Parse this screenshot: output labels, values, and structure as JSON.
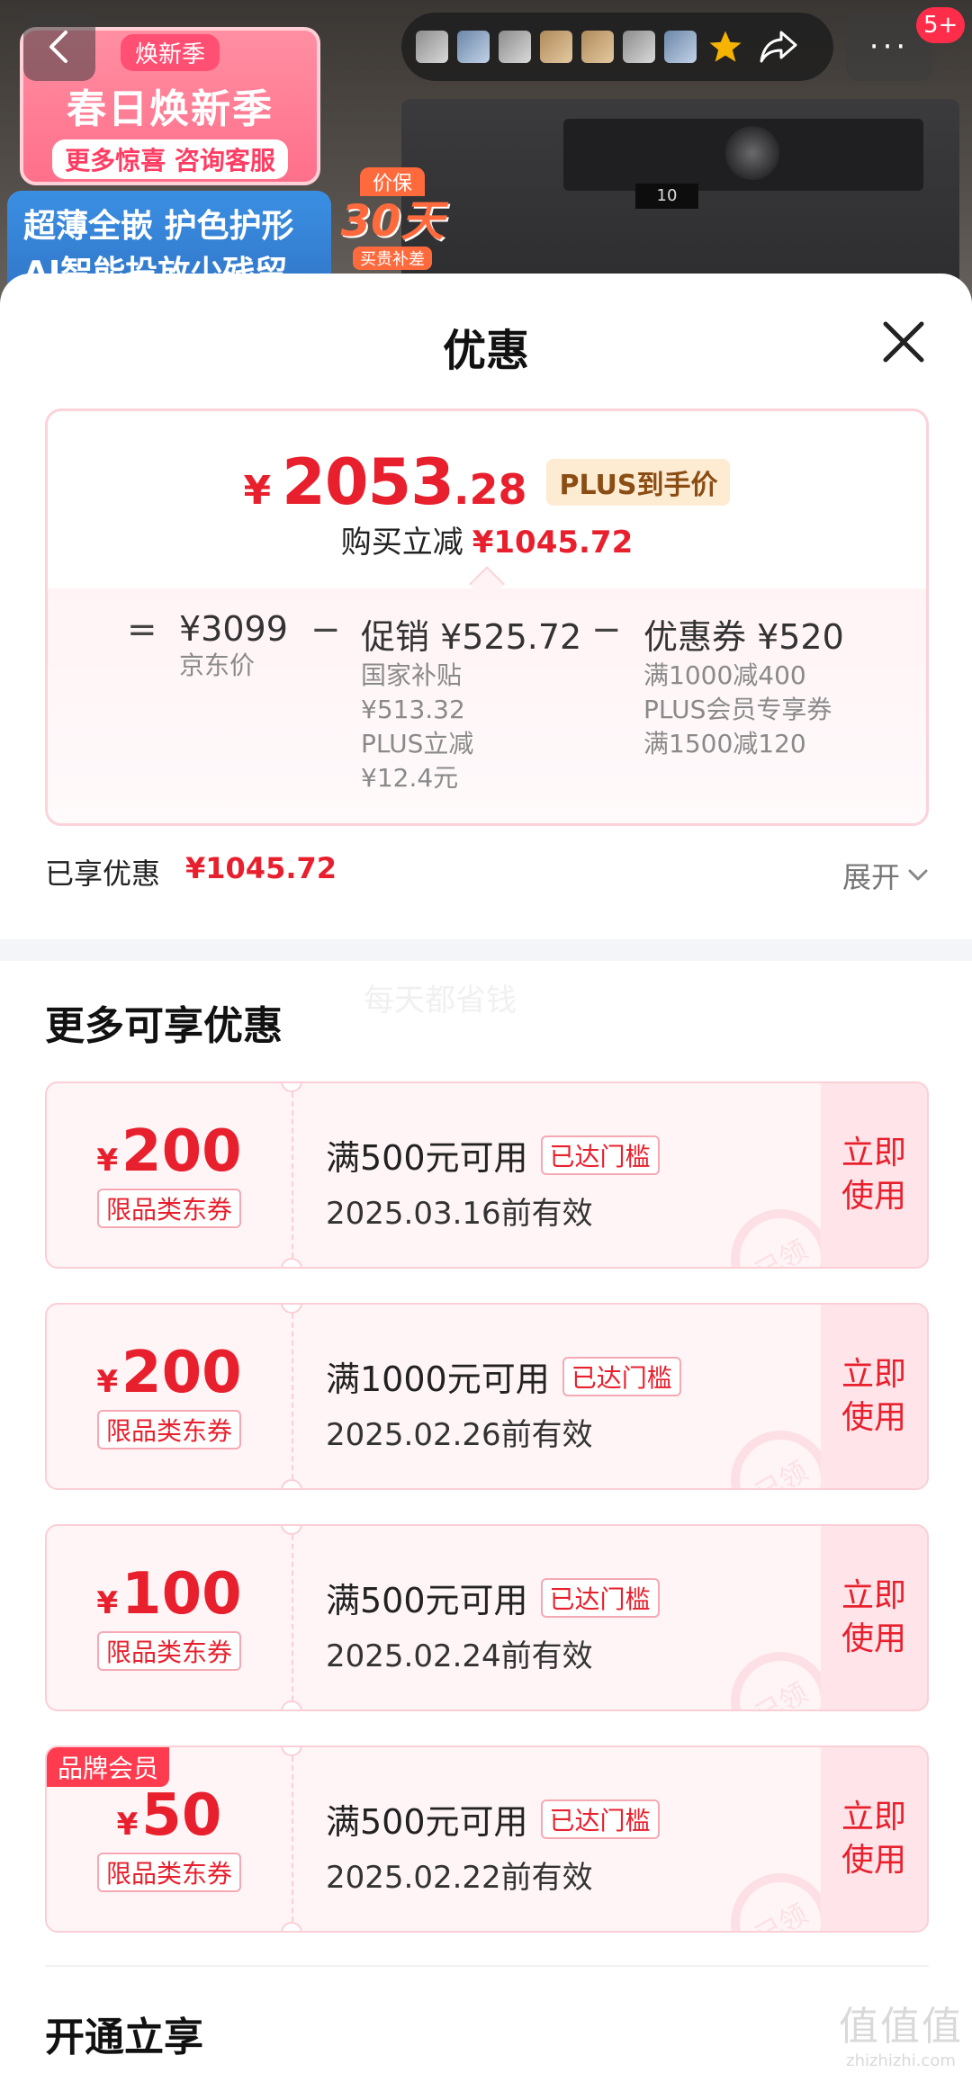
{
  "hero": {
    "promo_tag": "焕新季",
    "promo_main": "春日焕新季",
    "promo_sub": "更多惊喜 咨询客服",
    "feature_lines": [
      "超薄全嵌 护色护形",
      "AI智能投放少残留"
    ],
    "price_guard_top": "价保",
    "price_guard_mid": "30天",
    "price_guard_bot": "买贵补差",
    "washer_display": "10",
    "badge": "5+",
    "more": "···"
  },
  "sheet": {
    "title": "优惠"
  },
  "summary": {
    "final_price": {
      "symbol": "¥",
      "integer": "2053",
      "decimal": ".28",
      "tag": "PLUS到手价"
    },
    "instant_cut": {
      "label": "购买立减",
      "amount": "¥1045.72"
    },
    "calc": {
      "eq": "=",
      "minus": "−",
      "jd_price": {
        "main": "¥3099",
        "sub": "京东价"
      },
      "promo": {
        "main": "促销 ¥525.72",
        "lines": [
          "国家补贴",
          "¥513.32",
          "PLUS立减",
          "¥12.4元"
        ]
      },
      "coupon": {
        "main": "优惠券 ¥520",
        "lines": [
          "满1000减400",
          "PLUS会员专享券",
          "满1500减120"
        ]
      }
    }
  },
  "enjoyed": {
    "label": "已享优惠",
    "amount": "¥1045.72",
    "expand": "展开"
  },
  "watermark": "每天都省钱",
  "more_section": {
    "title": "更多可享优惠"
  },
  "coupons": [
    {
      "symbol": "¥",
      "amount": "200",
      "category": "限品类东券",
      "condition": "满500元可用",
      "reached": "已达门槛",
      "valid": "2025.03.16前有效",
      "use_label": "立即使用",
      "use_line1": "立即",
      "use_line2": "使用",
      "stamp": "已领",
      "member_tag": ""
    },
    {
      "symbol": "¥",
      "amount": "200",
      "category": "限品类东券",
      "condition": "满1000元可用",
      "reached": "已达门槛",
      "valid": "2025.02.26前有效",
      "use_label": "立即使用",
      "use_line1": "立即",
      "use_line2": "使用",
      "stamp": "已领",
      "member_tag": ""
    },
    {
      "symbol": "¥",
      "amount": "100",
      "category": "限品类东券",
      "condition": "满500元可用",
      "reached": "已达门槛",
      "valid": "2025.02.24前有效",
      "use_label": "立即使用",
      "use_line1": "立即",
      "use_line2": "使用",
      "stamp": "已领",
      "member_tag": ""
    },
    {
      "symbol": "¥",
      "amount": "50",
      "category": "限品类东券",
      "condition": "满500元可用",
      "reached": "已达门槛",
      "valid": "2025.02.22前有效",
      "use_label": "立即使用",
      "use_line1": "立即",
      "use_line2": "使用",
      "stamp": "已领",
      "member_tag": "品牌会员"
    }
  ],
  "open_section": {
    "title": "开通立享"
  },
  "site_mark": {
    "glyphs": "值值值",
    "url": "zhizhizhi.com"
  },
  "colors": {
    "price_red": "#e8202d",
    "plus_tag_bg": "#fdebd2",
    "coupon_bg": "#fff5f6",
    "coupon_border": "#fbcfd6"
  },
  "icons": {
    "back": "chevron-left-icon",
    "favorite": "star-icon",
    "share": "share-icon",
    "close": "close-icon",
    "expand": "chevron-down-icon"
  }
}
